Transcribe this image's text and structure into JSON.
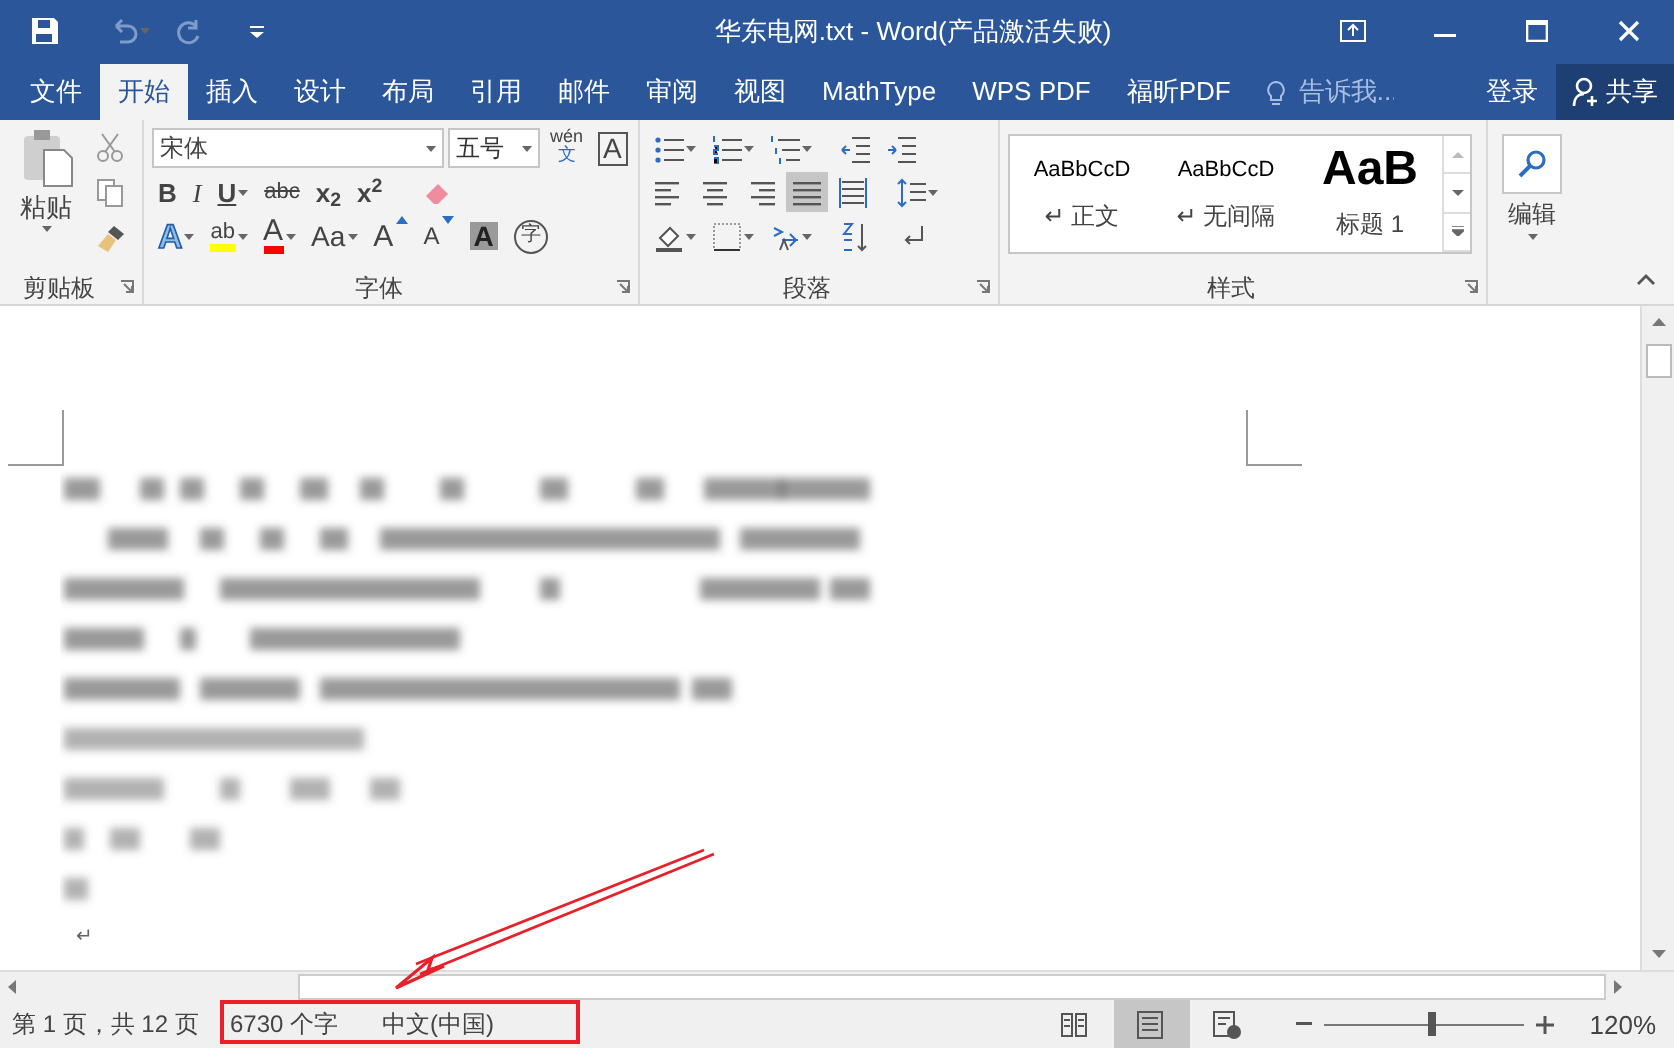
{
  "window": {
    "title": "华东电网.txt - Word(产品激活失败)"
  },
  "tabs": [
    {
      "label": "文件",
      "selected": false
    },
    {
      "label": "开始",
      "selected": true
    },
    {
      "label": "插入",
      "selected": false
    },
    {
      "label": "设计",
      "selected": false
    },
    {
      "label": "布局",
      "selected": false
    },
    {
      "label": "引用",
      "selected": false
    },
    {
      "label": "邮件",
      "selected": false
    },
    {
      "label": "审阅",
      "selected": false
    },
    {
      "label": "视图",
      "selected": false
    },
    {
      "label": "MathType",
      "selected": false
    },
    {
      "label": "WPS PDF",
      "selected": false
    },
    {
      "label": "福昕PDF",
      "selected": false
    }
  ],
  "tell_me": {
    "placeholder": "告诉我..."
  },
  "sign_in": "登录",
  "share": "共享",
  "ribbon": {
    "clipboard": {
      "paste": "粘贴",
      "label": "剪贴板"
    },
    "font": {
      "font_name": "宋体",
      "font_size": "五号",
      "phonetic_top": "wén",
      "phonetic_bottom": "文",
      "border_char": "A",
      "row2": [
        {
          "kind": "bold",
          "dropdown": false,
          "text": "B"
        },
        {
          "kind": "italic",
          "dropdown": false,
          "text": "I"
        },
        {
          "kind": "underline",
          "dropdown": true,
          "text": "U"
        },
        {
          "kind": "strike",
          "dropdown": false,
          "text": "abc"
        },
        {
          "kind": "bold",
          "dropdown": false,
          "text": "x$_{2}$"
        },
        {
          "kind": "bold",
          "dropdown": false,
          "text": "x$^{2}$"
        }
      ],
      "row3": [
        {
          "kind": "effect",
          "dropdown": true,
          "text": "A"
        },
        {
          "kind": "highlight",
          "dropdown": true,
          "text": "ab"
        },
        {
          "kind": "fontcolor",
          "dropdown": true,
          "text": "A"
        },
        {
          "kind": "plain",
          "dropdown": true,
          "text": "Aa"
        },
        {
          "kind": "grow",
          "dropdown": false,
          "text": "A"
        },
        {
          "kind": "shrink",
          "dropdown": false,
          "text": "A"
        },
        {
          "kind": "shaded",
          "dropdown": false,
          "text": "A"
        },
        {
          "kind": "circled",
          "dropdown": false,
          "text": "字"
        }
      ],
      "label": "字体"
    },
    "paragraph": {
      "alignments": [
        {
          "kind": "left",
          "selected": false
        },
        {
          "kind": "center",
          "selected": false
        },
        {
          "kind": "right",
          "selected": false
        },
        {
          "kind": "justify",
          "selected": true
        }
      ],
      "label": "段落"
    },
    "styles": {
      "items": [
        {
          "sample": "AaBbCcD",
          "name": "正文",
          "mark": "↵",
          "kind": "normal"
        },
        {
          "sample": "AaBbCcD",
          "name": "无间隔",
          "mark": "↵",
          "kind": "normal"
        },
        {
          "sample": "AaB",
          "name": "标题 1",
          "kind": "heading"
        }
      ],
      "label": "样式"
    },
    "editing": {
      "label": "编辑"
    }
  },
  "document": {
    "paragraph_mark": "↵"
  },
  "status_bar": {
    "page": "第 1 页，共 12 页",
    "words": "6730 个字",
    "language": "中文(中国)",
    "views": [
      {
        "kind": "read",
        "selected": false
      },
      {
        "kind": "print",
        "selected": true
      },
      {
        "kind": "web",
        "selected": false
      }
    ],
    "zoom": {
      "level": 0.54,
      "text": "120%"
    }
  }
}
